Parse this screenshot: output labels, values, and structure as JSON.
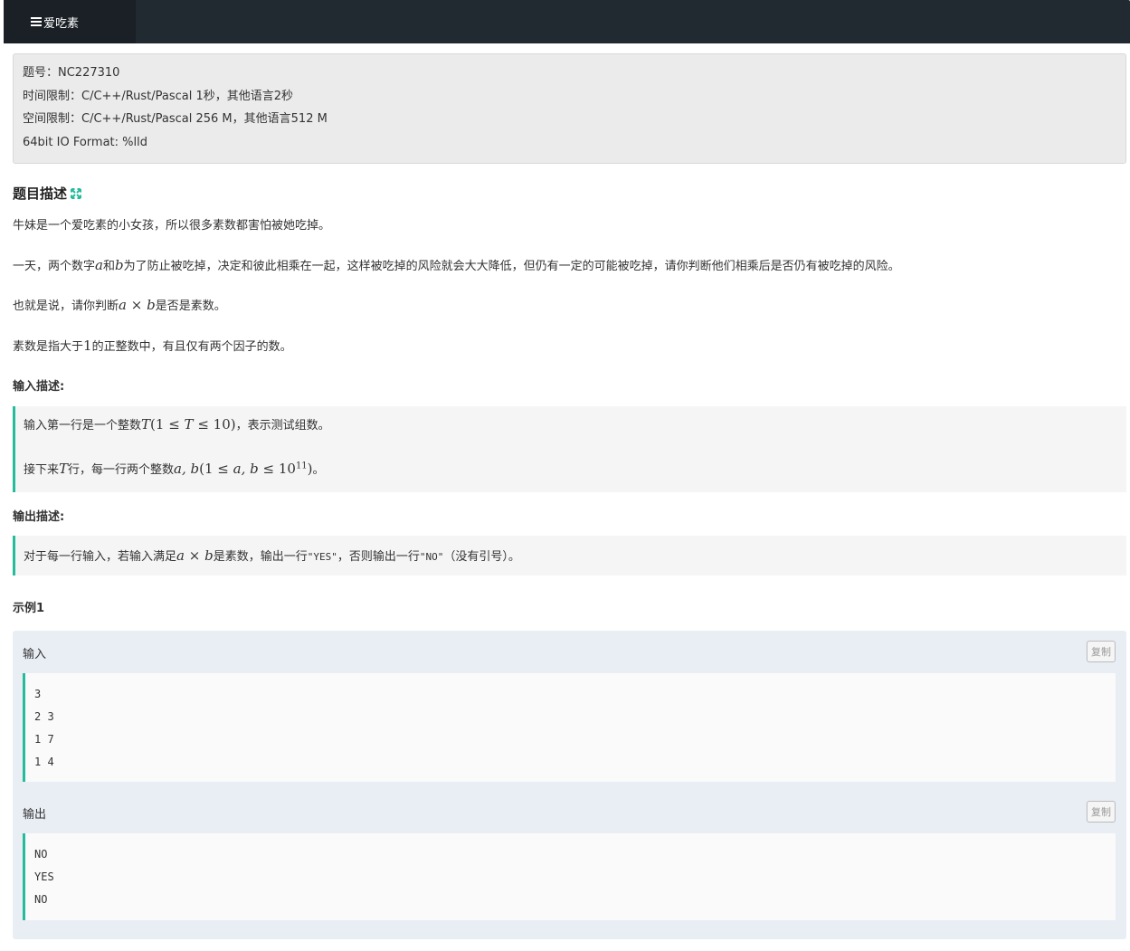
{
  "topbar": {
    "tab_label": "爱吃素",
    "tab_icon": "list-icon"
  },
  "meta": {
    "problem_id": "题号：NC227310",
    "time_limit": "时间限制：C/C++/Rust/Pascal 1秒，其他语言2秒",
    "space_limit": "空间限制：C/C++/Rust/Pascal 256 M，其他语言512 M",
    "io_format": "64bit IO Format: %lld"
  },
  "description": {
    "heading": "题目描述",
    "expand_icon": "expand-icon",
    "p1": "牛妹是一个爱吃素的小女孩，所以很多素数都害怕被她吃掉。",
    "p2": {
      "t1": "一天，两个数字",
      "a": "a",
      "t2": "和",
      "b": "b",
      "t3": "为了防止被吃掉，决定和彼此相乘在一起，这样被吃掉的风险就会大大降低，但仍有一定的可能被吃掉，请你判断他们相乘后是否仍有被吃掉的风险。"
    },
    "p3": {
      "t1": "也就是说，请你判断",
      "expr_a": "a",
      "times": " × ",
      "expr_b": "b",
      "t2": "是否是素数。"
    },
    "p4": {
      "t1": "素数是指大于",
      "one": "1",
      "t2": "的正整数中，有且仅有两个因子的数。"
    }
  },
  "input_desc": {
    "heading": "输入描述:",
    "line1": {
      "t1": "输入第一行是一个整数",
      "T": "T",
      "range": "(1 ≤ ",
      "T2": "T",
      "range2": " ≤ 10)",
      "t2": "，表示测试组数。"
    },
    "line2": {
      "t1": "接下来",
      "T": "T",
      "t2": "行，每一行两个整数",
      "ab": "a, b",
      "r1": "(1 ≤ ",
      "ab2": "a, b",
      "r2": " ≤ 10",
      "sup": "11",
      "r3": ")",
      "t3": "。"
    }
  },
  "output_desc": {
    "heading": "输出描述:",
    "line1": {
      "t1": "对于每一行输入，若输入满足",
      "a": "a",
      "times": " × ",
      "b": "b",
      "t2": "是素数，输出一行",
      "yes": "\"YES\"",
      "t3": "，否则输出一行",
      "no": "\"NO\"",
      "t4": "（没有引号）。"
    }
  },
  "example": {
    "heading": "示例1",
    "input_label": "输入",
    "output_label": "输出",
    "copy_label": "复制",
    "input_lines": [
      "3",
      "2 3",
      "1 7",
      "1 4"
    ],
    "output_lines": [
      "NO",
      "YES",
      "NO"
    ]
  },
  "colors": {
    "accent": "#25bb9b",
    "topbar": "#222a31"
  }
}
